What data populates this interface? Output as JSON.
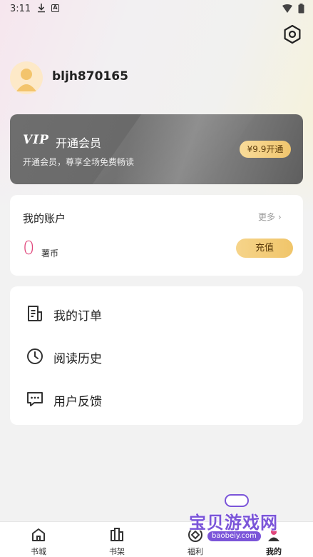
{
  "status_bar": {
    "time": "3:11",
    "download_icon": "download-icon",
    "notification_icon": "a-notification-icon",
    "wifi_icon": "wifi-icon",
    "battery_icon": "battery-icon"
  },
  "header": {
    "settings_icon": "settings-hexagon-icon"
  },
  "profile": {
    "username": "bljh870165",
    "avatar_icon": "default-avatar-icon"
  },
  "vip": {
    "logo": "VIP",
    "title": "开通会员",
    "description": "开通会员，尊享全场免费畅读",
    "button_label": "¥9.9开通"
  },
  "account": {
    "title": "我的账户",
    "more_label": "更多 ›",
    "coin_value": "0",
    "coin_unit": "薯币",
    "recharge_label": "充值"
  },
  "menu": [
    {
      "label": "我的订单",
      "icon": "order-document-icon"
    },
    {
      "label": "阅读历史",
      "icon": "clock-history-icon"
    },
    {
      "label": "用户反馈",
      "icon": "feedback-chat-icon"
    }
  ],
  "bottom_nav": [
    {
      "label": "书城",
      "icon": "home-icon"
    },
    {
      "label": "书架",
      "icon": "bookshelf-icon"
    },
    {
      "label": "福利",
      "icon": "welfare-icon"
    },
    {
      "label": "我的",
      "icon": "profile-icon"
    }
  ],
  "watermark": {
    "title": "宝贝游戏网",
    "url": "baobeiy.com"
  },
  "colors": {
    "accent_pink": "#e0467b",
    "gold_button": "#f0c56e",
    "vip_card": "#6e6e6e",
    "watermark_purple": "#7b55d9"
  }
}
